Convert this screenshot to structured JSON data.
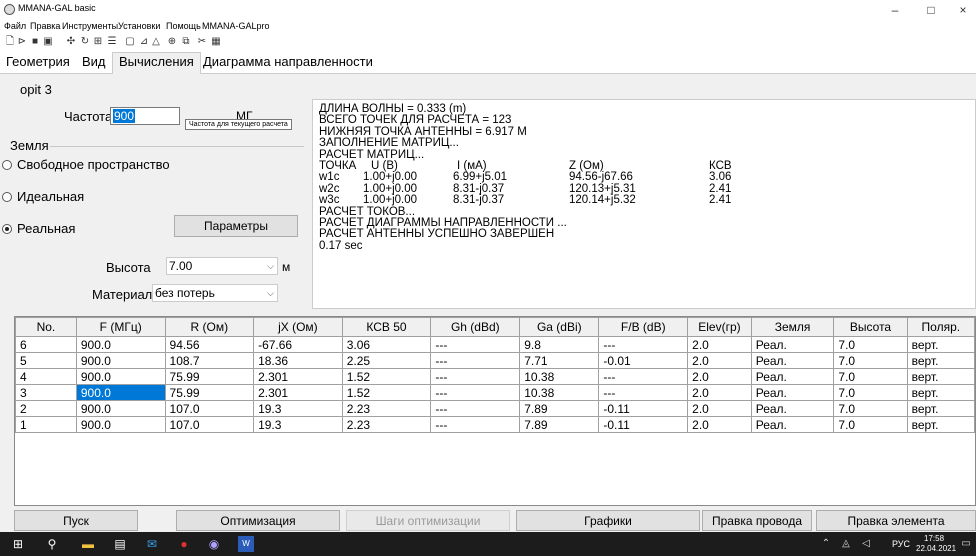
{
  "window": {
    "title": "MMANA-GAL basic",
    "min": "–",
    "max": "□",
    "close": "×"
  },
  "menu": [
    "Файл",
    "Правка",
    "Инструменты",
    "Установки",
    "Помощь",
    "MMANA-GALpro"
  ],
  "tabs": [
    "Геометрия",
    "Вид",
    "Вычисления",
    "Диаграмма направленности"
  ],
  "panel": {
    "name": "opit 3",
    "freq_label": "Частота",
    "freq_value": "900",
    "freq_unit": "МГ",
    "freq_tooltip": "Частота для текущего расчета",
    "ground_title": "Земля",
    "ground_options": [
      "Свободное пространство",
      "Идеальная",
      "Реальная"
    ],
    "params_button": "Параметры",
    "height_label": "Высота",
    "height_value": "7.00",
    "height_unit": "м",
    "material_label": "Материал",
    "material_value": "без потерь"
  },
  "output": {
    "lines": [
      "ДЛИНА ВОЛНЫ = 0.333 (m)",
      "ВСЕГО ТОЧЕК ДЛЯ РАСЧЕТА = 123",
      "НИЖНЯЯ ТОЧКА АНТЕННЫ = 6.917 М",
      "ЗАПОЛНЕНИЕ МАТРИЦ...",
      "РАСЧЕТ МАТРИЦ..."
    ],
    "table_header": [
      "ТОЧКА",
      "U (B)",
      "I (мА)",
      "Z (Ом)",
      "КСВ"
    ],
    "table_rows": [
      [
        "w1c",
        "1.00+j0.00",
        "6.99+j5.01",
        "94.56-j67.66",
        "3.06"
      ],
      [
        "w2c",
        "1.00+j0.00",
        "8.31-j0.37",
        "120.13+j5.31",
        "2.41"
      ],
      [
        "w3c",
        "1.00+j0.00",
        "8.31-j0.37",
        "120.14+j5.32",
        "2.41"
      ]
    ],
    "tail_lines": [
      "РАСЧЕТ ТОКОВ...",
      "РАСЧЕТ ДИАГРАММЫ НАПРАВЛЕННОСТИ ...",
      "РАСЧЕТ АНТЕННЫ УСПЕШНО ЗАВЕРШЕН",
      "0.17 sec"
    ]
  },
  "grid": {
    "columns": [
      "No.",
      "F (МГц)",
      "R (Ом)",
      "jX (Ом)",
      "КСВ 50",
      "Gh (dBd)",
      "Ga (dBi)",
      "F/B (dB)",
      "Elev(гр)",
      "Земля",
      "Высота",
      "Поляр."
    ],
    "rows": [
      [
        "6",
        "900.0",
        "94.56",
        "-67.66",
        "3.06",
        "---",
        "9.8",
        "---",
        "2.0",
        "Реал.",
        "7.0",
        "верт."
      ],
      [
        "5",
        "900.0",
        "108.7",
        "18.36",
        "2.25",
        "---",
        "7.71",
        "-0.01",
        "2.0",
        "Реал.",
        "7.0",
        "верт."
      ],
      [
        "4",
        "900.0",
        "75.99",
        "2.301",
        "1.52",
        "---",
        "10.38",
        "---",
        "2.0",
        "Реал.",
        "7.0",
        "верт."
      ],
      [
        "3",
        "900.0",
        "75.99",
        "2.301",
        "1.52",
        "---",
        "10.38",
        "---",
        "2.0",
        "Реал.",
        "7.0",
        "верт."
      ],
      [
        "2",
        "900.0",
        "107.0",
        "19.3",
        "2.23",
        "---",
        "7.89",
        "-0.11",
        "2.0",
        "Реал.",
        "7.0",
        "верт."
      ],
      [
        "1",
        "900.0",
        "107.0",
        "19.3",
        "2.23",
        "---",
        "7.89",
        "-0.11",
        "2.0",
        "Реал.",
        "7.0",
        "верт."
      ]
    ],
    "selected": {
      "row": 3,
      "col": 1
    }
  },
  "buttons": {
    "start": "Пуск",
    "optimize": "Оптимизация",
    "opt_steps": "Шаги оптимизации",
    "charts": "Графики",
    "edit_wire": "Правка провода",
    "edit_element": "Правка элемента"
  },
  "taskbar": {
    "lang": "РУС",
    "time": "17:58",
    "date": "22.04.2021"
  }
}
